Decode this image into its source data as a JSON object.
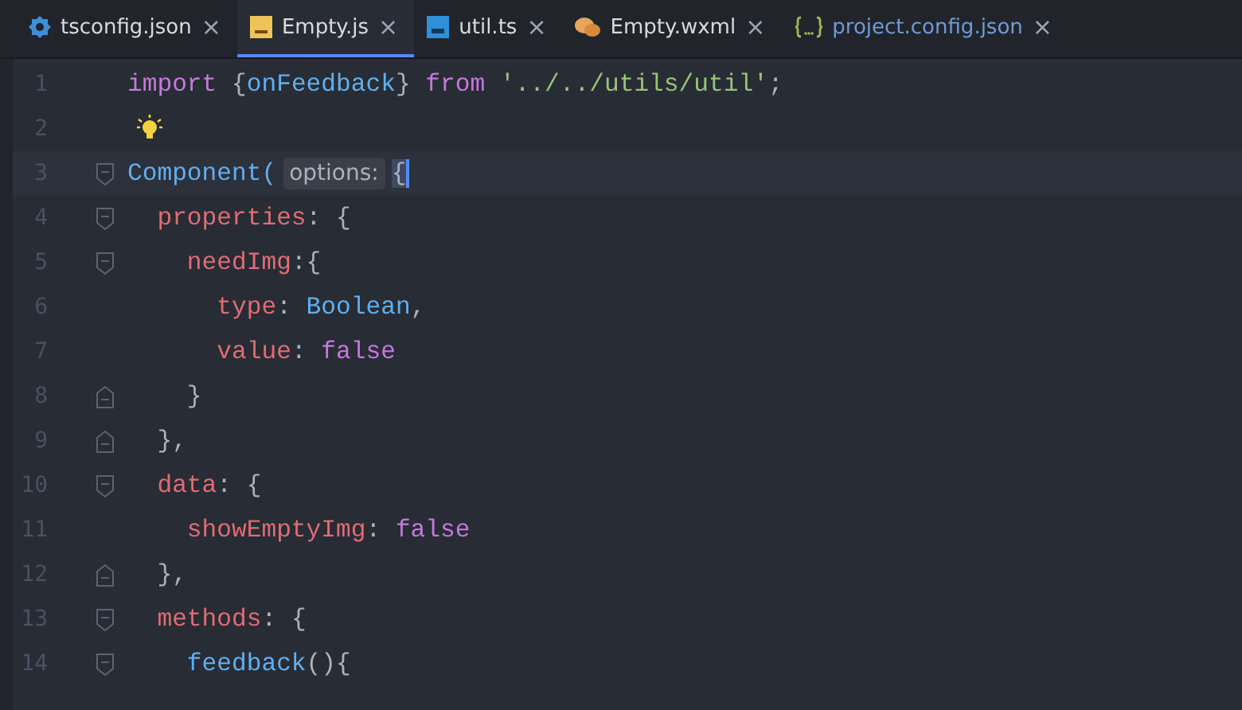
{
  "tabs": [
    {
      "label": "tsconfig.json",
      "kind": "config",
      "selected": false,
      "modified": false
    },
    {
      "label": "Empty.js",
      "kind": "script",
      "selected": true,
      "modified": false
    },
    {
      "label": "util.ts",
      "kind": "typescript",
      "selected": false,
      "modified": false
    },
    {
      "label": "Empty.wxml",
      "kind": "markup",
      "selected": false,
      "modified": false
    },
    {
      "label": "project.config.json",
      "kind": "data",
      "selected": false,
      "modified": true
    }
  ],
  "close_glyph": "×",
  "lines": [
    {
      "number": "1",
      "current": false,
      "bulb": false,
      "fold_start": false,
      "fold_end": false,
      "tokens": [
        {
          "kind": "keyword",
          "text": "import "
        },
        {
          "kind": "punct",
          "text": "{"
        },
        {
          "kind": "fn",
          "text": "onFeedback"
        },
        {
          "kind": "punct",
          "text": "} "
        },
        {
          "kind": "keyword",
          "text": "from "
        },
        {
          "kind": "string",
          "text": "'../../utils/util'"
        },
        {
          "kind": "punct",
          "text": ";"
        }
      ]
    },
    {
      "number": "2",
      "current": false,
      "bulb": true,
      "fold_start": false,
      "fold_end": false
    },
    {
      "number": "3",
      "current": true,
      "bulb": false,
      "fold_start": true,
      "fold_end": false,
      "tokens": [
        {
          "kind": "fn",
          "text": "Component("
        },
        {
          "kind": "hint",
          "text": "options:"
        },
        {
          "kind": "match",
          "text": "{"
        }
      ]
    },
    {
      "number": "4",
      "current": false,
      "bulb": false,
      "fold_start": true,
      "fold_end": false,
      "tokens": [
        {
          "kind": "prop",
          "text": "  properties"
        },
        {
          "kind": "punct",
          "text": ": {"
        }
      ]
    },
    {
      "number": "5",
      "current": false,
      "bulb": false,
      "fold_start": true,
      "fold_end": false,
      "tokens": [
        {
          "kind": "prop",
          "text": "    needImg"
        },
        {
          "kind": "punct",
          "text": ":{"
        }
      ]
    },
    {
      "number": "6",
      "current": false,
      "bulb": false,
      "fold_start": false,
      "fold_end": false,
      "tokens": [
        {
          "kind": "prop",
          "text": "      type"
        },
        {
          "kind": "punct",
          "text": ": "
        },
        {
          "kind": "fn",
          "text": "Boolean"
        },
        {
          "kind": "punct",
          "text": ","
        }
      ]
    },
    {
      "number": "7",
      "current": false,
      "bulb": false,
      "fold_start": false,
      "fold_end": false,
      "tokens": [
        {
          "kind": "prop",
          "text": "      value"
        },
        {
          "kind": "punct",
          "text": ": "
        },
        {
          "kind": "keyword",
          "text": "false"
        }
      ]
    },
    {
      "number": "8",
      "current": false,
      "bulb": false,
      "fold_start": false,
      "fold_end": true,
      "tokens": [
        {
          "kind": "punct",
          "text": "    }"
        }
      ]
    },
    {
      "number": "9",
      "current": false,
      "bulb": false,
      "fold_start": false,
      "fold_end": true,
      "tokens": [
        {
          "kind": "punct",
          "text": "  },"
        }
      ]
    },
    {
      "number": "10",
      "current": false,
      "bulb": false,
      "fold_start": true,
      "fold_end": false,
      "tokens": [
        {
          "kind": "prop",
          "text": "  data"
        },
        {
          "kind": "punct",
          "text": ": {"
        }
      ]
    },
    {
      "number": "11",
      "current": false,
      "bulb": false,
      "fold_start": false,
      "fold_end": false,
      "tokens": [
        {
          "kind": "prop",
          "text": "    showEmptyImg"
        },
        {
          "kind": "punct",
          "text": ": "
        },
        {
          "kind": "keyword",
          "text": "false"
        }
      ]
    },
    {
      "number": "12",
      "current": false,
      "bulb": false,
      "fold_start": false,
      "fold_end": true,
      "tokens": [
        {
          "kind": "punct",
          "text": "  },"
        }
      ]
    },
    {
      "number": "13",
      "current": false,
      "bulb": false,
      "fold_start": true,
      "fold_end": false,
      "tokens": [
        {
          "kind": "prop",
          "text": "  methods"
        },
        {
          "kind": "punct",
          "text": ": {"
        }
      ]
    },
    {
      "number": "14",
      "current": false,
      "bulb": false,
      "fold_start": true,
      "fold_end": false,
      "tokens": [
        {
          "kind": "fn",
          "text": "    feedback"
        },
        {
          "kind": "punct",
          "text": "(){"
        }
      ]
    }
  ]
}
